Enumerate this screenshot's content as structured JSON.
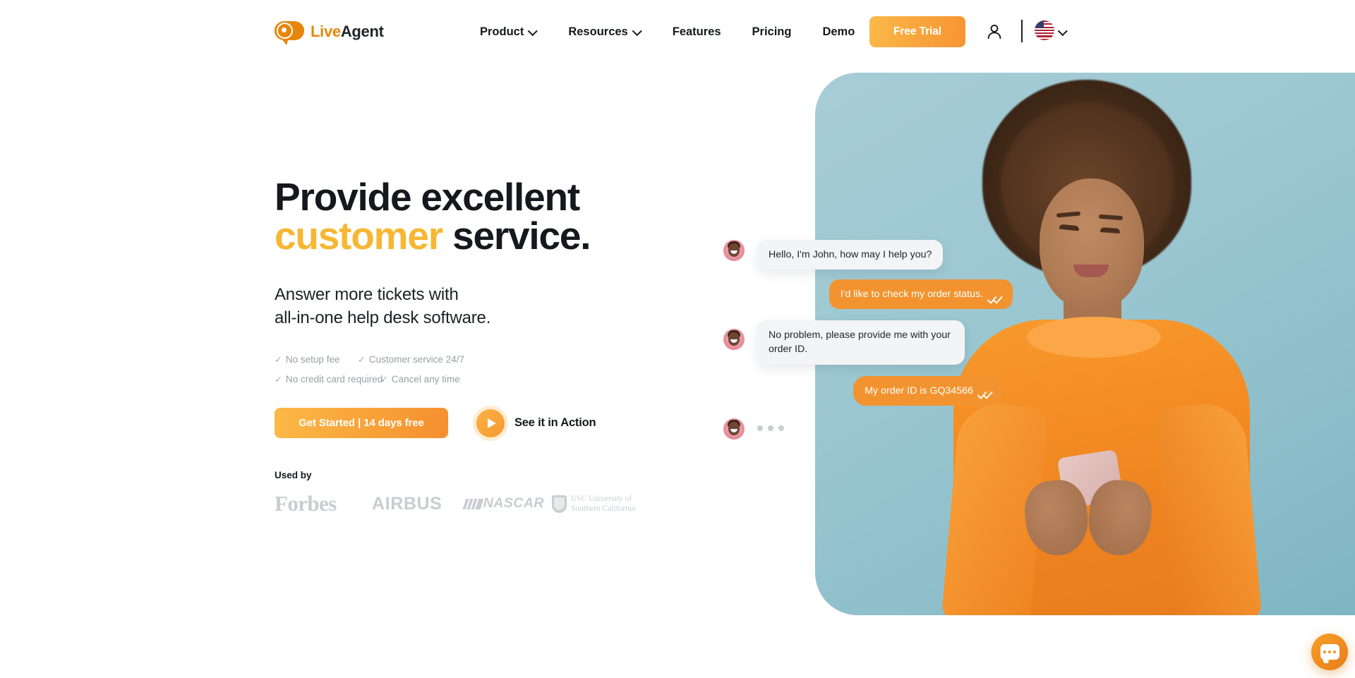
{
  "header": {
    "logo": {
      "at_icon": "at-speech-bubble-icon",
      "text_live": "Live",
      "text_agent": "Agent"
    },
    "nav": [
      {
        "label": "Product",
        "has_chevron": true
      },
      {
        "label": "Resources",
        "has_chevron": true
      },
      {
        "label": "Features",
        "has_chevron": false
      },
      {
        "label": "Pricing",
        "has_chevron": false
      },
      {
        "label": "Demo",
        "has_chevron": false
      }
    ],
    "free_trial_label": "Free Trial",
    "account_icon": "user-account-icon",
    "language": {
      "flag": "us-flag-icon",
      "chevron": "chevron-down-icon"
    }
  },
  "hero": {
    "headline_line1": "Provide excellent",
    "headline_accent": "customer",
    "headline_line2_rest": " service.",
    "subhead_line1": "Answer more tickets with",
    "subhead_line2": "all-in-one help desk software.",
    "perks": [
      "No setup fee",
      "Customer service 24/7",
      "No credit card required",
      "Cancel any time"
    ],
    "perk_check": "✓",
    "cta_primary": "Get Started | 14 days free",
    "cta_secondary": "See it in Action",
    "play_icon": "play-icon",
    "used_by_label": "Used by",
    "brands": [
      {
        "name": "Forbes",
        "icon": "forbes-logo"
      },
      {
        "name": "AIRBUS",
        "icon": "airbus-logo"
      },
      {
        "name": "NASCAR",
        "icon": "nascar-logo"
      },
      {
        "name": "USC University of\nSouthern California",
        "icon": "usc-logo"
      }
    ],
    "usc_line1": "USC University of",
    "usc_line2": "Southern California",
    "image_alt": "woman-in-orange-sweater-using-phone"
  },
  "chat": [
    {
      "from": "agent",
      "text": "Hello, I'm John, how may I help you?",
      "avatar": "agent-avatar",
      "read": false
    },
    {
      "from": "user",
      "text": "I'd like to check my order status.",
      "read": true
    },
    {
      "from": "agent",
      "text": "No problem, please provide me with your order ID.",
      "avatar": "agent-avatar",
      "read": false
    },
    {
      "from": "user",
      "text": "My order ID is GQ34566",
      "read": true
    },
    {
      "from": "agent",
      "text": "",
      "avatar": "agent-avatar",
      "typing": true
    }
  ],
  "widget": {
    "icon": "chat-bubble-icon",
    "label": "Open live chat"
  },
  "colors": {
    "accent_orange": "#f3932f",
    "accent_yellow": "#f7b733",
    "brand_orange": "#e8860c",
    "text_dark": "#15181d",
    "muted": "#9aa0a6",
    "bubble_gray": "#f3f4f5",
    "hero_bg": "#9dc8d2"
  }
}
